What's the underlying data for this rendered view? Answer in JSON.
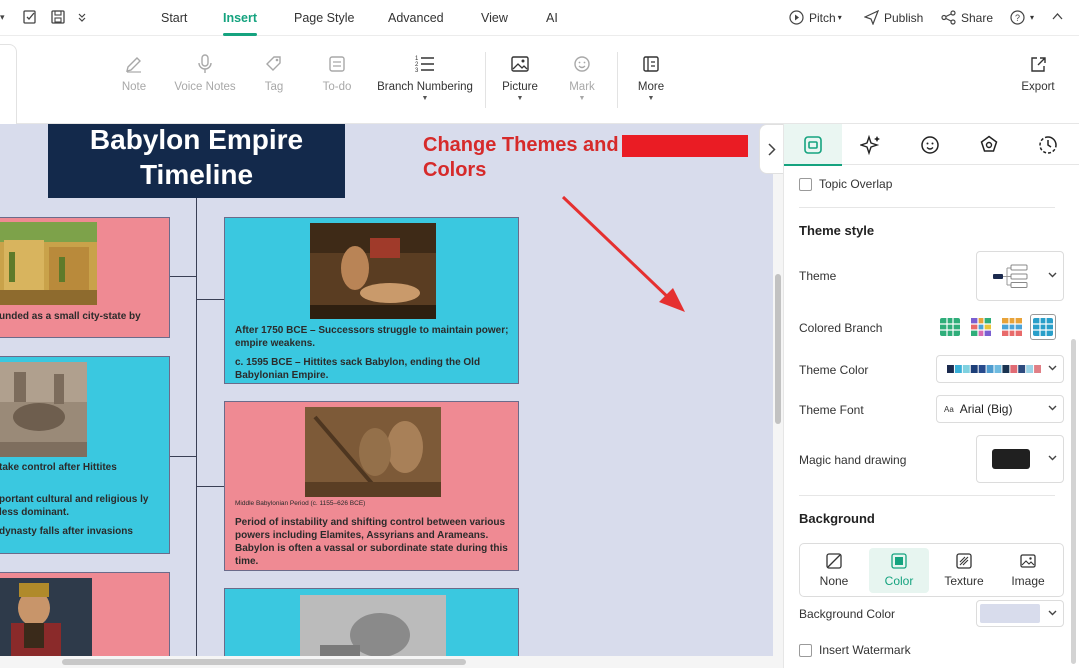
{
  "menubar": {
    "tabs": [
      "Start",
      "Insert",
      "Page Style",
      "Advanced",
      "View",
      "AI"
    ],
    "active_tab": "Insert",
    "right_actions": {
      "pitch": "Pitch",
      "publish": "Publish",
      "share": "Share"
    }
  },
  "ribbon": {
    "tools": {
      "note": "Note",
      "voice_notes": "Voice Notes",
      "tag": "Tag",
      "todo": "To-do",
      "branch_numbering": "Branch Numbering",
      "picture": "Picture",
      "mark": "Mark",
      "more": "More",
      "export": "Export"
    }
  },
  "canvas": {
    "title": "Babylon Empire Timeline",
    "annotation": "Change Themes and Colors",
    "nodes": {
      "left1": {
        "text": "unded as a small city-state by"
      },
      "right1": {
        "text1": "After 1750 BCE – Successors struggle to maintain power; empire weakens.",
        "text2": "c. 1595 BCE – Hittites sack Babylon, ending the Old Babylonian Empire."
      },
      "left2": {
        "text1": "take control after Hittites",
        "text2": "portant cultural and religious ly less dominant.",
        "text3": "dynasty falls after invasions"
      },
      "right2": {
        "caption": "Middle Babylonian Period (c. 1155–626 BCE)",
        "text": "Period of instability and shifting control between various powers including Elamites, Assyrians and Arameans.  Babylon is often a vassal or subordinate state during this time."
      }
    }
  },
  "panel": {
    "topic_overlap": "Topic Overlap",
    "theme_style": "Theme style",
    "theme": "Theme",
    "colored_branch": "Colored Branch",
    "theme_color": "Theme Color",
    "theme_color_swatches": [
      "#1b2a4e",
      "#3ab0d8",
      "#7fd1e0",
      "#1d3f78",
      "#274a8c",
      "#4e9ccf",
      "#6fbbe0",
      "#1a3350",
      "#e06b74",
      "#2d4b7e",
      "#9ad3e6",
      "#e07f86"
    ],
    "theme_font": "Theme Font",
    "theme_font_value": "Arial (Big)",
    "theme_font_prefix": "Aa",
    "magic_hand_drawing": "Magic hand drawing",
    "magic_color": "#202020",
    "background": "Background",
    "bg_options": [
      "None",
      "Color",
      "Texture",
      "Image"
    ],
    "bg_active": "Color",
    "background_color": "Background Color",
    "background_color_value": "#d8dcec",
    "insert_watermark": "Insert Watermark"
  },
  "colors": {
    "accent": "#15a37f",
    "annotation": "#d62a2a",
    "title_bg": "#13294b",
    "pink": "#ef8a93",
    "cyan": "#3ac8e0"
  }
}
